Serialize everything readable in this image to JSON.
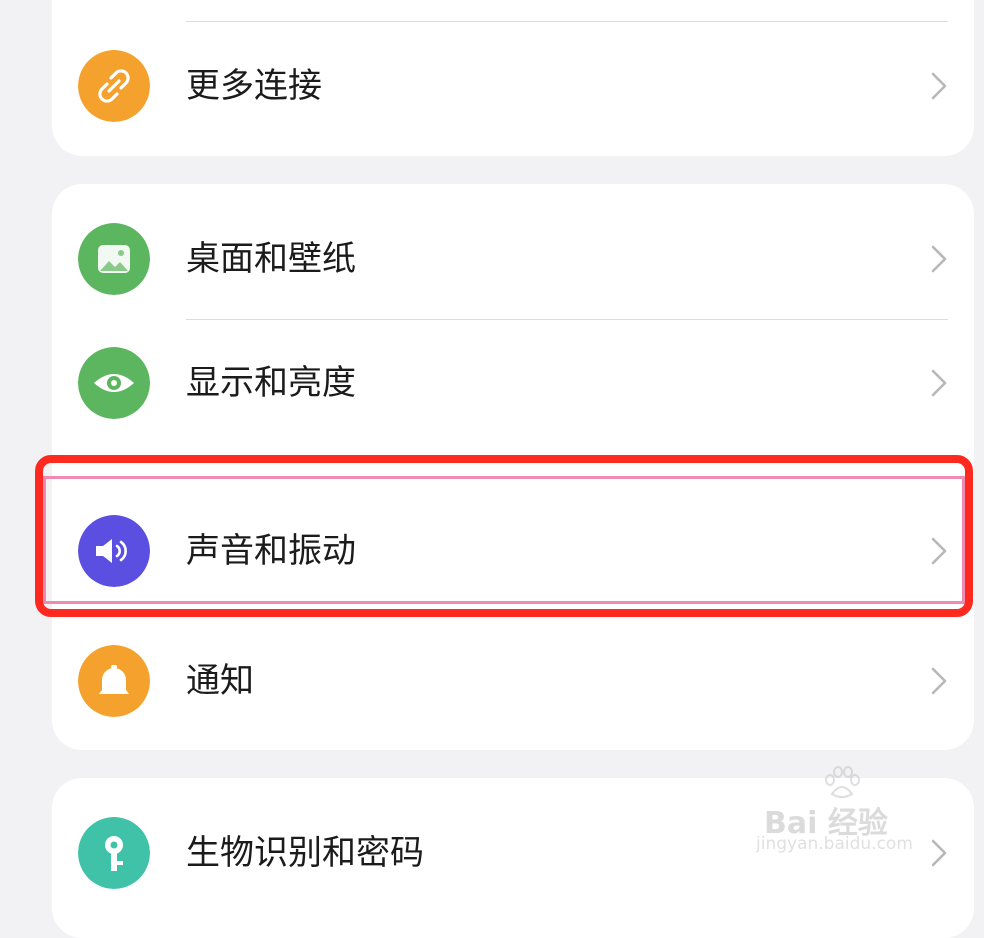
{
  "groups": [
    {
      "items": [
        {
          "label": "更多连接",
          "icon": "link-icon",
          "color": "#f5a12e"
        }
      ]
    },
    {
      "items": [
        {
          "label": "桌面和壁纸",
          "icon": "image-icon",
          "color": "#5cb660"
        },
        {
          "label": "显示和亮度",
          "icon": "eye-icon",
          "color": "#5cb660"
        },
        {
          "label": "声音和振动",
          "icon": "speaker-icon",
          "color": "#5a4fe0"
        },
        {
          "label": "通知",
          "icon": "bell-icon",
          "color": "#f5a12e"
        }
      ]
    },
    {
      "items": [
        {
          "label": "生物识别和密码",
          "icon": "key-icon",
          "color": "#3fc2a8"
        }
      ]
    }
  ],
  "highlight_color": "#ff2a1f",
  "watermark": {
    "brand": "Bai 经验",
    "url": "jingyan.baidu.com"
  }
}
